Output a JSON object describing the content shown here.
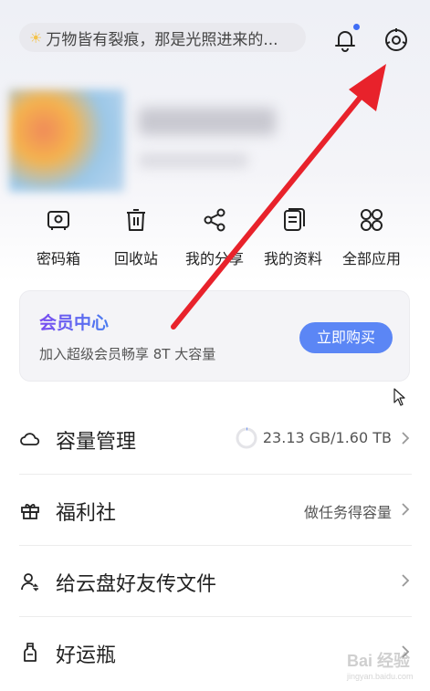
{
  "header": {
    "quote_icon": "sun-icon",
    "quote_text": "万物皆有裂痕，那是光照进来的...",
    "notification_icon": "bell-icon",
    "settings_icon": "settings-icon"
  },
  "quick_actions": [
    {
      "label": "密码箱",
      "icon": "safe-icon"
    },
    {
      "label": "回收站",
      "icon": "trash-icon"
    },
    {
      "label": "我的分享",
      "icon": "share-icon"
    },
    {
      "label": "我的资料",
      "icon": "document-icon"
    },
    {
      "label": "全部应用",
      "icon": "apps-grid-icon"
    }
  ],
  "vip": {
    "title": "会员中心",
    "subtitle": "加入超级会员畅享 8T 大容量",
    "button": "立即购买",
    "button_color": "#5b86f5"
  },
  "menu": [
    {
      "title": "容量管理",
      "icon": "cloud-icon",
      "right": "23.13 GB/1.60 TB",
      "usage_fraction": 0.0141
    },
    {
      "title": "福利社",
      "icon": "gift-icon",
      "right": "做任务得容量"
    },
    {
      "title": "给云盘好友传文件",
      "icon": "user-transfer-icon",
      "right": ""
    },
    {
      "title": "好运瓶",
      "icon": "bottle-icon",
      "right": ""
    }
  ],
  "annotation": {
    "arrow_color": "#e8222b"
  },
  "watermark": {
    "text": "Bai 经验",
    "sub": "jingyan.baidu.com"
  }
}
